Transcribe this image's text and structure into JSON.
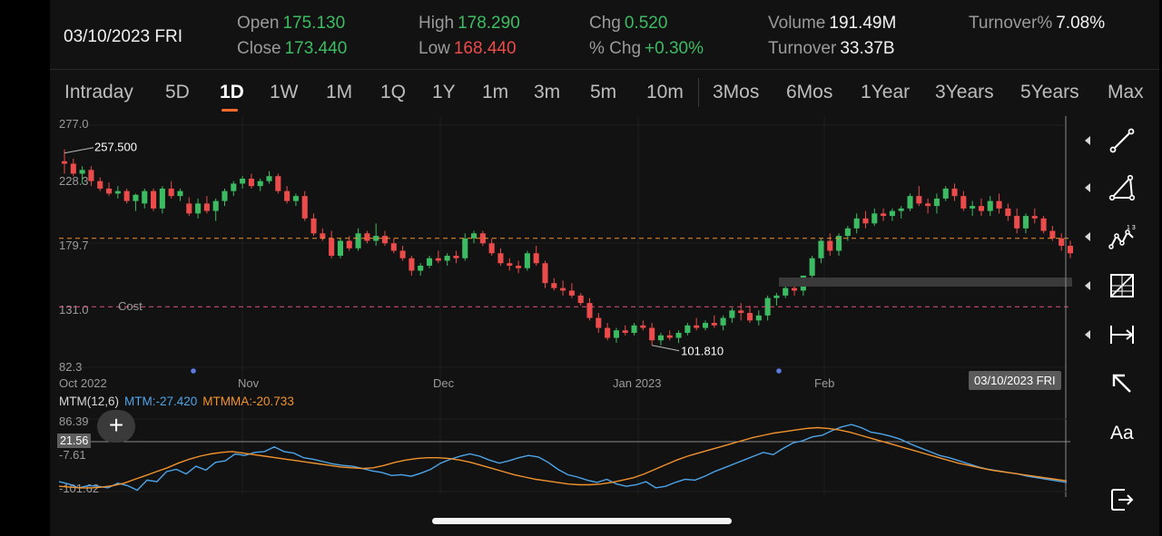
{
  "header": {
    "date": "03/10/2023 FRI",
    "open_label": "Open",
    "open": "175.130",
    "close_label": "Close",
    "close": "173.440",
    "high_label": "High",
    "high": "178.290",
    "low_label": "Low",
    "low": "168.440",
    "chg_label": "Chg",
    "chg": "0.520",
    "pchg_label": "% Chg",
    "pchg": "+0.30%",
    "volume_label": "Volume",
    "volume": "191.49M",
    "turnover_label": "Turnover",
    "turnover": "33.37B",
    "turnover_pct_label": "Turnover%",
    "turnover_pct": "7.08%"
  },
  "tabs": [
    {
      "label": "Intraday"
    },
    {
      "label": "5D"
    },
    {
      "label": "1D",
      "active": true
    },
    {
      "label": "1W"
    },
    {
      "label": "1M"
    },
    {
      "label": "1Q"
    },
    {
      "label": "1Y"
    },
    {
      "label": "1m"
    },
    {
      "label": "3m"
    },
    {
      "label": "5m"
    },
    {
      "label": "10m"
    },
    {
      "label": "3Mos"
    },
    {
      "label": "6Mos"
    },
    {
      "label": "1Year"
    },
    {
      "label": "3Years"
    },
    {
      "label": "5Years"
    },
    {
      "label": "Max"
    }
  ],
  "chart_data": {
    "type": "candlestick",
    "y_axis_labels": [
      "277.0",
      "228.3",
      "179.7",
      "131.0",
      "82.3"
    ],
    "ylim": [
      82.3,
      277.0
    ],
    "x_axis_labels": [
      "Oct 2022",
      "Nov",
      "Dec",
      "Jan 2023",
      "Feb"
    ],
    "max_annotation": "257.500",
    "min_annotation": "101.810",
    "cost_label": "Cost",
    "cost_value": 131.0,
    "last_price": 186.0,
    "hover_date": "03/10/2023 FRI",
    "candles": [
      [
        248,
        257.5,
        238,
        246
      ],
      [
        246,
        250,
        236,
        238
      ],
      [
        238,
        244,
        230,
        241
      ],
      [
        241,
        244,
        228,
        232
      ],
      [
        232,
        235,
        224,
        226
      ],
      [
        226,
        231,
        220,
        222
      ],
      [
        222,
        228,
        218,
        224
      ],
      [
        224,
        226,
        214,
        216
      ],
      [
        216,
        222,
        208,
        221
      ],
      [
        214,
        226,
        210,
        224
      ],
      [
        224,
        226,
        208,
        210
      ],
      [
        210,
        228,
        206,
        226
      ],
      [
        226,
        232,
        218,
        220
      ],
      [
        220,
        226,
        216,
        224
      ],
      [
        214,
        219,
        204,
        206
      ],
      [
        206,
        218,
        202,
        214
      ],
      [
        214,
        220,
        206,
        208
      ],
      [
        208,
        218,
        200,
        216
      ],
      [
        216,
        226,
        212,
        224
      ],
      [
        224,
        232,
        220,
        230
      ],
      [
        230,
        236,
        226,
        234
      ],
      [
        234,
        238,
        226,
        228
      ],
      [
        228,
        234,
        224,
        232
      ],
      [
        232,
        240,
        230,
        236
      ],
      [
        236,
        238,
        222,
        224
      ],
      [
        224,
        228,
        214,
        216
      ],
      [
        216,
        222,
        212,
        220
      ],
      [
        220,
        224,
        200,
        202
      ],
      [
        202,
        206,
        188,
        190
      ],
      [
        190,
        194,
        184,
        186
      ],
      [
        186,
        192,
        170,
        172
      ],
      [
        172,
        186,
        170,
        184
      ],
      [
        184,
        188,
        176,
        178
      ],
      [
        178,
        194,
        176,
        190
      ],
      [
        190,
        192,
        182,
        184
      ],
      [
        184,
        198,
        180,
        188
      ],
      [
        188,
        192,
        180,
        182
      ],
      [
        182,
        186,
        174,
        176
      ],
      [
        176,
        180,
        168,
        170
      ],
      [
        170,
        172,
        156,
        160
      ],
      [
        160,
        166,
        156,
        164
      ],
      [
        164,
        172,
        162,
        170
      ],
      [
        170,
        176,
        166,
        168
      ],
      [
        168,
        174,
        164,
        172
      ],
      [
        172,
        176,
        166,
        170
      ],
      [
        170,
        190,
        168,
        186
      ],
      [
        186,
        192,
        182,
        190
      ],
      [
        190,
        192,
        180,
        182
      ],
      [
        182,
        186,
        172,
        174
      ],
      [
        174,
        178,
        164,
        166
      ],
      [
        166,
        170,
        160,
        164
      ],
      [
        164,
        168,
        158,
        162
      ],
      [
        162,
        176,
        160,
        174
      ],
      [
        174,
        180,
        164,
        166
      ],
      [
        166,
        168,
        146,
        150
      ],
      [
        150,
        154,
        144,
        146
      ],
      [
        146,
        152,
        140,
        144
      ],
      [
        144,
        150,
        138,
        140
      ],
      [
        140,
        142,
        132,
        134
      ],
      [
        134,
        138,
        120,
        122
      ],
      [
        122,
        126,
        110,
        114
      ],
      [
        114,
        118,
        104,
        106
      ],
      [
        106,
        114,
        102,
        112
      ],
      [
        112,
        116,
        108,
        110
      ],
      [
        110,
        118,
        108,
        116
      ],
      [
        116,
        120,
        112,
        114
      ],
      [
        114,
        118,
        100,
        104
      ],
      [
        104,
        110,
        100,
        108
      ],
      [
        108,
        112,
        104,
        106
      ],
      [
        106,
        112,
        101.8,
        110
      ],
      [
        110,
        118,
        108,
        116
      ],
      [
        116,
        122,
        112,
        114
      ],
      [
        114,
        120,
        112,
        118
      ],
      [
        118,
        124,
        114,
        116
      ],
      [
        116,
        124,
        112,
        122
      ],
      [
        122,
        130,
        118,
        128
      ],
      [
        128,
        134,
        120,
        126
      ],
      [
        126,
        132,
        118,
        120
      ],
      [
        120,
        128,
        116,
        124
      ],
      [
        124,
        140,
        120,
        138
      ],
      [
        138,
        142,
        132,
        140
      ],
      [
        140,
        148,
        138,
        146
      ],
      [
        146,
        150,
        140,
        144
      ],
      [
        144,
        156,
        140,
        156
      ],
      [
        156,
        172,
        152,
        170
      ],
      [
        170,
        186,
        166,
        184
      ],
      [
        184,
        190,
        172,
        176
      ],
      [
        176,
        190,
        172,
        188
      ],
      [
        188,
        196,
        184,
        194
      ],
      [
        194,
        206,
        190,
        202
      ],
      [
        202,
        208,
        194,
        198
      ],
      [
        198,
        210,
        196,
        206
      ],
      [
        206,
        210,
        200,
        204
      ],
      [
        204,
        210,
        200,
        208
      ],
      [
        208,
        212,
        202,
        210
      ],
      [
        210,
        222,
        208,
        220
      ],
      [
        220,
        228,
        212,
        214
      ],
      [
        214,
        218,
        206,
        212
      ],
      [
        212,
        222,
        206,
        218
      ],
      [
        218,
        228,
        216,
        226
      ],
      [
        226,
        230,
        216,
        220
      ],
      [
        220,
        224,
        208,
        210
      ],
      [
        210,
        216,
        204,
        212
      ],
      [
        212,
        218,
        204,
        208
      ],
      [
        208,
        220,
        204,
        216
      ],
      [
        216,
        222,
        206,
        210
      ],
      [
        210,
        214,
        200,
        204
      ],
      [
        204,
        210,
        190,
        194
      ],
      [
        194,
        206,
        190,
        204
      ],
      [
        204,
        210,
        198,
        202
      ],
      [
        202,
        204,
        190,
        192
      ],
      [
        192,
        196,
        184,
        186
      ],
      [
        186,
        190,
        176,
        180
      ],
      [
        180,
        184,
        170,
        174
      ]
    ]
  },
  "indicator": {
    "title": "MTM(12,6)",
    "mtm_label": "MTM:-27.420",
    "mtmma_label": "MTMMA:-20.733",
    "y_labels": [
      "86.39",
      "-7.61",
      "-101.62"
    ],
    "current_tag": "21.56",
    "mtm": [
      -76,
      -82,
      -92,
      -86,
      -88,
      -92,
      -80,
      -86,
      -98,
      -72,
      -76,
      -50,
      -44,
      -56,
      -36,
      -46,
      -26,
      -22,
      -4,
      -8,
      0,
      2,
      14,
      2,
      -2,
      -14,
      -18,
      -24,
      -30,
      -34,
      -36,
      -42,
      -48,
      -52,
      -60,
      -58,
      -62,
      -54,
      -44,
      -28,
      -18,
      -10,
      -4,
      -10,
      -20,
      -28,
      -22,
      -14,
      -8,
      -12,
      -26,
      -44,
      -58,
      -64,
      -72,
      -78,
      -70,
      -82,
      -88,
      -84,
      -76,
      -92,
      -88,
      -78,
      -70,
      -72,
      -62,
      -50,
      -40,
      -30,
      -20,
      -10,
      0,
      -6,
      10,
      24,
      30,
      40,
      44,
      56,
      66,
      72,
      64,
      52,
      48,
      42,
      34,
      22,
      12,
      2,
      -8,
      -14,
      -22,
      -30,
      -38,
      -44,
      -48,
      -52,
      -56,
      -62,
      -66,
      -70,
      -74,
      -78
    ],
    "mtmma": [
      -88,
      -90,
      -92,
      -92,
      -90,
      -86,
      -80,
      -70,
      -60,
      -50,
      -40,
      -28,
      -18,
      -10,
      -4,
      0,
      2,
      -2,
      -6,
      -10,
      -14,
      -18,
      -22,
      -26,
      -30,
      -34,
      -38,
      -40,
      -42,
      -40,
      -34,
      -26,
      -20,
      -16,
      -14,
      -14,
      -16,
      -20,
      -26,
      -34,
      -42,
      -50,
      -58,
      -64,
      -70,
      -74,
      -78,
      -82,
      -84,
      -84,
      -82,
      -78,
      -72,
      -66,
      -56,
      -44,
      -32,
      -20,
      -10,
      -2,
      6,
      14,
      22,
      30,
      38,
      44,
      50,
      54,
      58,
      62,
      64,
      62,
      58,
      52,
      44,
      36,
      28,
      20,
      12,
      4,
      -4,
      -12,
      -20,
      -28,
      -34,
      -40,
      -46,
      -50,
      -54,
      -58,
      -62,
      -66,
      -70,
      -74
    ],
    "ylim": [
      -101.62,
      86.39
    ]
  },
  "toolbar": {
    "items": [
      {
        "name": "trend-line-tool-icon"
      },
      {
        "name": "triangle-tool-icon"
      },
      {
        "name": "wave-pattern-tool-icon"
      },
      {
        "name": "fibonacci-box-tool-icon"
      },
      {
        "name": "range-measure-tool-icon"
      },
      {
        "name": "arrow-tool-icon"
      },
      {
        "name": "text-tool",
        "label": "Aa"
      },
      {
        "name": "exit-drawing-icon"
      }
    ]
  }
}
